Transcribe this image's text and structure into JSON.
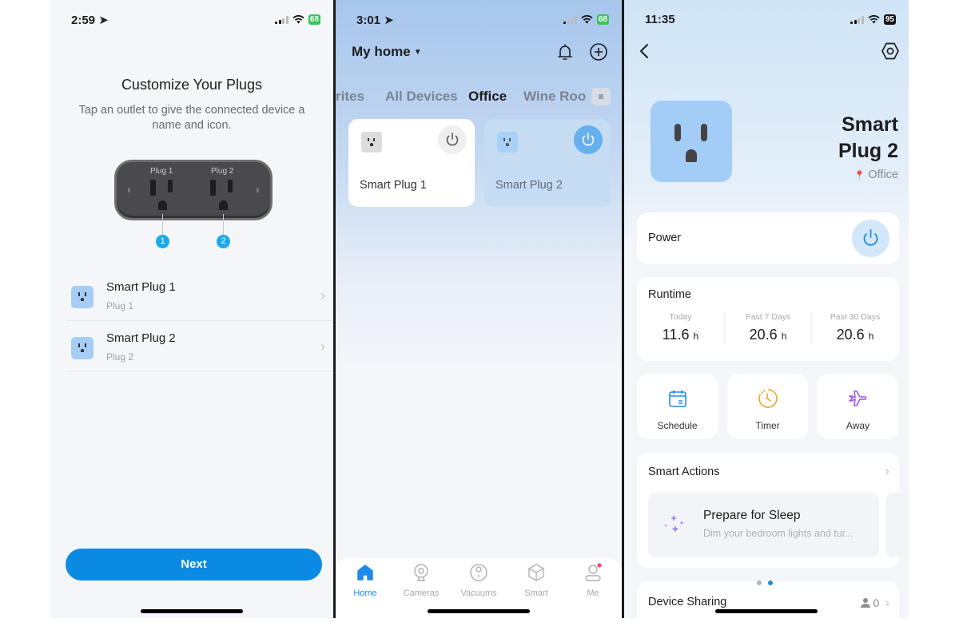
{
  "screen1": {
    "status": {
      "time": "2:59",
      "battery": "68"
    },
    "title": "Customize Your Plugs",
    "subtitle": "Tap an outlet to give the connected device a name and icon.",
    "diagram": {
      "labels": [
        "Plug 1",
        "Plug 2"
      ],
      "callouts": [
        "1",
        "2"
      ]
    },
    "plugs": [
      {
        "name": "Smart Plug 1",
        "outlet": "Plug 1",
        "icon": "outlet-icon"
      },
      {
        "name": "Smart Plug 2",
        "outlet": "Plug 2",
        "icon": "outlet-icon"
      }
    ],
    "next_label": "Next",
    "colors": {
      "accent": "#0a8ae3",
      "callout": "#1aa9ec",
      "icon_bg": "#a6cdf6"
    }
  },
  "screen2": {
    "status": {
      "time": "3:01",
      "battery": "68"
    },
    "home_selector": "My home",
    "tabs": [
      {
        "label": "rites",
        "active": false
      },
      {
        "label": "All Devices",
        "active": false
      },
      {
        "label": "Office",
        "active": true
      },
      {
        "label": "Wine Roo",
        "active": false
      }
    ],
    "devices": [
      {
        "name": "Smart Plug 1",
        "power": "off"
      },
      {
        "name": "Smart Plug 2",
        "power": "on"
      }
    ],
    "tabbar": [
      {
        "label": "Home",
        "icon": "home-icon",
        "active": true
      },
      {
        "label": "Cameras",
        "icon": "camera-icon",
        "active": false
      },
      {
        "label": "Vacuums",
        "icon": "vacuum-icon",
        "active": false
      },
      {
        "label": "Smart",
        "icon": "cube-icon",
        "active": false
      },
      {
        "label": "Me",
        "icon": "person-icon",
        "active": false,
        "badge": true
      }
    ]
  },
  "screen3": {
    "status": {
      "time": "11:35",
      "battery": "95"
    },
    "device_name_line1": "Smart",
    "device_name_line2": "Plug 2",
    "room": "Office",
    "power_label": "Power",
    "runtime": {
      "title": "Runtime",
      "unit": "h",
      "columns": [
        {
          "label": "Today",
          "value": "11.6"
        },
        {
          "label": "Past 7 Days",
          "value": "20.6"
        },
        {
          "label": "Past 30 Days",
          "value": "20.6"
        }
      ]
    },
    "quick_actions": [
      {
        "label": "Schedule",
        "icon": "calendar-icon",
        "color": "#1d8ae8"
      },
      {
        "label": "Timer",
        "icon": "timer-icon",
        "color": "#f5a524"
      },
      {
        "label": "Away",
        "icon": "airplane-icon",
        "color": "#9b4fe8"
      }
    ],
    "smart_actions": {
      "title": "Smart Actions",
      "tile_title": "Prepare for Sleep",
      "tile_desc": "Dim your bedroom lights and tur..."
    },
    "pager": {
      "count": 2,
      "active": 2
    },
    "sharing": {
      "title": "Device Sharing",
      "count": "0"
    }
  }
}
